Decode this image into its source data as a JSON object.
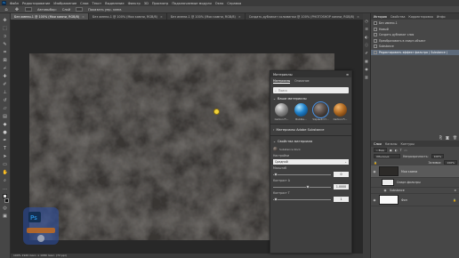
{
  "menubar": {
    "items": [
      "Файл",
      "Редактирование",
      "Изображение",
      "Слои",
      "Текст",
      "Выделение",
      "Фильтр",
      "3D",
      "Просмотр",
      "Подключаемые модули",
      "Окно",
      "Справка"
    ]
  },
  "options": {
    "items": [
      "Автовыбор:",
      "Слой",
      "Показать упр. элем."
    ]
  },
  "tabs": [
    {
      "label": "Без имени-1 @ 100% (Мои камни, RGB/8)",
      "active": true
    },
    {
      "label": "Без имени-1 @ 100% (Мои камни, RGB/8)",
      "active": false
    },
    {
      "label": "Без имени-1 @ 100% (Мои камни, RGB/8)",
      "active": false
    },
    {
      "label": "Создать дубликат соломинки @ 100% (PHOTOSHOP камни, RGB/8)",
      "active": false
    }
  ],
  "statusbar": {
    "text": "100%    1920 пикс. x 1080 пикс. (72 ppi)"
  },
  "materials": {
    "title": "Материалы",
    "tabs": [
      "Материалы",
      "Описание"
    ],
    "search_placeholder": "Поиск",
    "my_section": "Ваши материалы",
    "items": [
      {
        "label": "Carbon Fi...",
        "color": "#8c8c8c"
      },
      {
        "label": "Bubble...",
        "color": "#1e7fc8"
      },
      {
        "label": "Чёрный Ст...",
        "color": "#5a4f4a"
      },
      {
        "label": "Carbon Fi...",
        "color": "#b06a22"
      }
    ],
    "substance_section": "Материалы Adobe Substance",
    "props_section": "Свойства материала",
    "material_name": "Substance Rock",
    "preset_label": "Настройки",
    "preset_value": "Средний",
    "params": [
      {
        "label": "Масштаб",
        "value": "0",
        "fraction": 0.05
      },
      {
        "label": "Контраст A",
        "value": "1.0000",
        "fraction": 0.6
      },
      {
        "label": "Контраст T",
        "value": "1",
        "fraction": 0.05
      }
    ]
  },
  "right": {
    "history_tabs": [
      "История",
      "Свойства",
      "Корректировка",
      "Инфо"
    ],
    "history_items": [
      {
        "label": "Без имени-1",
        "selected": false
      },
      {
        "label": "Новый",
        "selected": false
      },
      {
        "label": "Создать дубликат слоя",
        "selected": false
      },
      {
        "label": "Преобразовать в смарт-объект",
        "selected": false
      },
      {
        "label": "Substance",
        "selected": false
      },
      {
        "label": "Редактировать эффект фильтра ( Substance )",
        "selected": true
      }
    ],
    "layer_tabs": [
      "Слои",
      "Каналы",
      "Контуры"
    ],
    "layer_filter": "Вид",
    "blend_mode": "Обычные",
    "opacity_label": "Непрозрачность:",
    "opacity_value": "100%",
    "fill_label": "Заливка:",
    "fill_value": "100%",
    "layers": [
      {
        "name": "Мои камни",
        "selected": true
      },
      {
        "name": "Смарт-фильтры",
        "selected": false
      },
      {
        "name": "Substance",
        "selected": false
      },
      {
        "name": "Фон",
        "selected": false
      }
    ]
  }
}
